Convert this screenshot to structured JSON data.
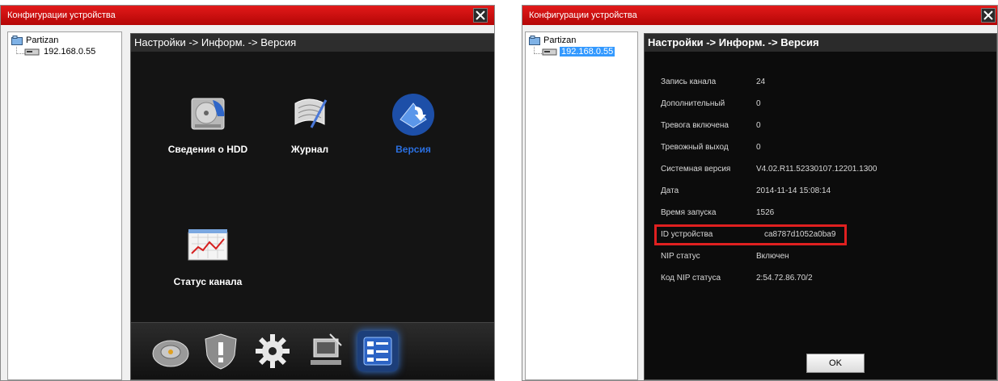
{
  "window_left": {
    "title": "Конфигурации устройства",
    "tree": {
      "root": "Partizan",
      "device": "192.168.0.55"
    },
    "breadcrumb": "Настройки -> Информ. -> Версия",
    "tiles": [
      {
        "label": "Сведения о HDD",
        "icon": "hdd-icon"
      },
      {
        "label": "Журнал",
        "icon": "log-icon"
      },
      {
        "label": "Версия",
        "icon": "version-icon",
        "active": true
      },
      {
        "label": "Статус канала",
        "icon": "channel-status-icon"
      }
    ],
    "dock": [
      "disk-icon",
      "alarm-shield-icon",
      "settings-gear-icon",
      "network-icon",
      "info-list-icon"
    ]
  },
  "window_right": {
    "title": "Конфигурации устройства",
    "tree": {
      "root": "Partizan",
      "device": "192.168.0.55"
    },
    "breadcrumb": "Настройки -> Информ. -> Версия",
    "info": [
      {
        "key": "Запись канала",
        "value": "24"
      },
      {
        "key": "Дополнительный",
        "value": "0"
      },
      {
        "key": "Тревога включена",
        "value": "0"
      },
      {
        "key": "Тревожный выход",
        "value": "0"
      },
      {
        "key": "Системная версия",
        "value": "V4.02.R11.52330107.12201.1300"
      },
      {
        "key": "Дата",
        "value": "2014-11-14 15:08:14"
      },
      {
        "key": "Время запуска",
        "value": "1526"
      },
      {
        "key": "ID устройства",
        "value": "ca8787d1052a0ba9"
      },
      {
        "key": "NIP статус",
        "value": "Включен"
      },
      {
        "key": "Код NIP статуса",
        "value": "2:54.72.86.70/2"
      }
    ],
    "ok_label": "OK"
  },
  "colors": {
    "titlebar": "#d10f0f",
    "active_tile": "#2a6fe0",
    "highlight": "#e02020",
    "selection": "#3399ff"
  }
}
